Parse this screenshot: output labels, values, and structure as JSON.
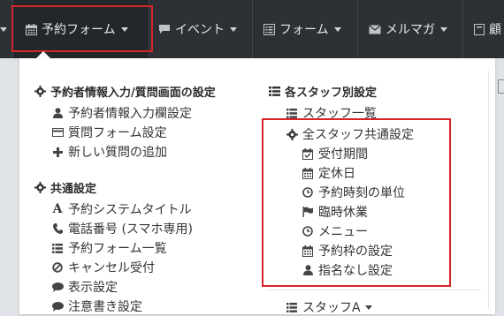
{
  "navbar": {
    "items": [
      {
        "label": "予約フォーム",
        "icon": "calendar-icon",
        "active": true
      },
      {
        "label": "イベント",
        "icon": "comment-icon"
      },
      {
        "label": "フォーム",
        "icon": "list-alt-icon"
      },
      {
        "label": "メルマガ",
        "icon": "envelope-icon"
      },
      {
        "label": "顧",
        "icon": "book-icon"
      }
    ]
  },
  "menu": {
    "left": {
      "section1": {
        "title": "予約者情報入力/質問画面の設定",
        "items": [
          {
            "label": "予約者情報入力欄設定",
            "icon": "user-icon"
          },
          {
            "label": "質問フォーム設定",
            "icon": "credit-card-icon"
          },
          {
            "label": "新しい質問の追加",
            "icon": "plus-icon"
          }
        ]
      },
      "section2": {
        "title": "共通設定",
        "items": [
          {
            "label": "予約システムタイトル",
            "icon": "font-icon"
          },
          {
            "label": "電話番号 (スマホ専用)",
            "icon": "phone-icon"
          },
          {
            "label": "予約フォーム一覧",
            "icon": "list-icon"
          },
          {
            "label": "キャンセル受付",
            "icon": "ban-icon"
          },
          {
            "label": "表示設定",
            "icon": "comment-icon"
          },
          {
            "label": "注意書き設定",
            "icon": "comment-icon"
          }
        ]
      }
    },
    "right": {
      "title": "各スタッフ別設定",
      "staff_list": "スタッフ一覧",
      "common": {
        "title": "全スタッフ共通設定",
        "items": [
          {
            "label": "受付期間",
            "icon": "calendar-check-icon"
          },
          {
            "label": "定休日",
            "icon": "calendar-icon"
          },
          {
            "label": "予約時刻の単位",
            "icon": "clock-icon"
          },
          {
            "label": "臨時休業",
            "icon": "flag-icon"
          },
          {
            "label": "メニュー",
            "icon": "clock-icon"
          },
          {
            "label": "予約枠の設定",
            "icon": "calendar-icon"
          },
          {
            "label": "指名なし設定",
            "icon": "user-icon"
          }
        ]
      },
      "staff_a": "スタッフA"
    }
  },
  "colors": {
    "navbar_bg": "#2d3136",
    "highlight": "#d6252a",
    "panel_bg": "#ffffff"
  }
}
